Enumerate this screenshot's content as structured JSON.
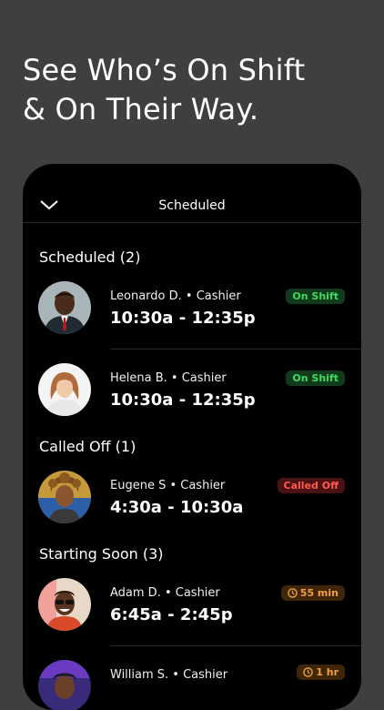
{
  "headline": {
    "line1": "See Who’s On Shift",
    "line2": "& On Their Way."
  },
  "topbar": {
    "title": "Scheduled"
  },
  "sections": [
    {
      "title": "Scheduled (2)"
    },
    {
      "title": "Called Off (1)"
    },
    {
      "title": "Starting Soon (3)"
    }
  ],
  "shifts": [
    {
      "name": "Leonardo D. • Cashier",
      "time": "10:30a - 12:35p",
      "badge": "On Shift"
    },
    {
      "name": "Helena B. • Cashier",
      "time": "10:30a - 12:35p",
      "badge": "On Shift"
    },
    {
      "name": "Eugene S • Cashier",
      "time": "4:30a - 10:30a",
      "badge": "Called Off"
    },
    {
      "name": "Adam D. • Cashier",
      "time": "6:45a - 2:45p",
      "badge": "55 min"
    },
    {
      "name": "William S. • Cashier",
      "time": "",
      "badge": "1 hr"
    }
  ],
  "colors": {
    "on_shift": "#3ddc5f",
    "called_off": "#ff5a4f",
    "starting": "#f2a03d"
  }
}
